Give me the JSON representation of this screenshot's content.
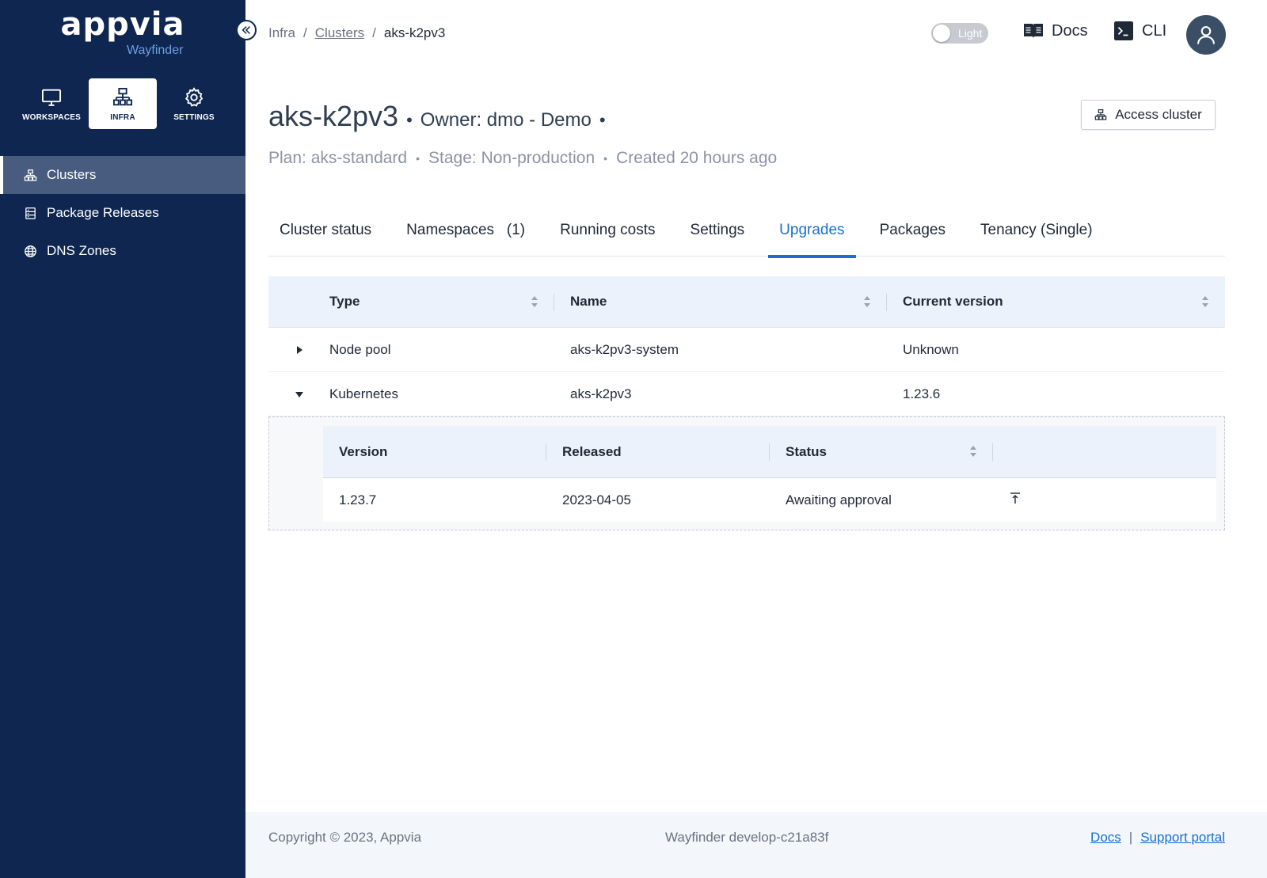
{
  "brand": {
    "name": "appvia",
    "product": "Wayfinder"
  },
  "topnav": [
    {
      "label": "WORKSPACES",
      "icon": "monitor-icon"
    },
    {
      "label": "INFRA",
      "icon": "network-icon",
      "active": true
    },
    {
      "label": "SETTINGS",
      "icon": "gear-icon"
    }
  ],
  "sidenav": [
    {
      "label": "Clusters",
      "icon": "cluster-icon",
      "active": true
    },
    {
      "label": "Package Releases",
      "icon": "package-icon"
    },
    {
      "label": "DNS Zones",
      "icon": "globe-icon"
    }
  ],
  "breadcrumb": {
    "root": "Infra",
    "sep": "/",
    "parent": "Clusters",
    "current": "aks-k2pv3"
  },
  "header": {
    "theme_toggle": "Light",
    "docs": "Docs",
    "cli": "CLI"
  },
  "cluster": {
    "name": "aks-k2pv3",
    "owner": "Owner: dmo - Demo",
    "dot": "•",
    "plan": "Plan: aks-standard",
    "stage": "Stage: Non-production",
    "created": "Created 20 hours ago",
    "access_button": "Access cluster"
  },
  "tabs": [
    {
      "label": "Cluster status"
    },
    {
      "label": "Namespaces   (1)"
    },
    {
      "label": "Running costs"
    },
    {
      "label": "Settings"
    },
    {
      "label": "Upgrades",
      "active": true
    },
    {
      "label": "Packages"
    },
    {
      "label": "Tenancy (Single)"
    }
  ],
  "upgrades_table": {
    "columns": [
      "Type",
      "Name",
      "Current version"
    ],
    "rows": [
      {
        "type": "Node pool",
        "name": "aks-k2pv3-system",
        "version": "Unknown",
        "expanded": false
      },
      {
        "type": "Kubernetes",
        "name": "aks-k2pv3",
        "version": "1.23.6",
        "expanded": true
      }
    ]
  },
  "versions_table": {
    "columns": [
      "Version",
      "Released",
      "Status"
    ],
    "rows": [
      {
        "version": "1.23.7",
        "released": "2023-04-05",
        "status": "Awaiting approval"
      }
    ]
  },
  "footer": {
    "copyright": "Copyright © 2023, Appvia",
    "build": "Wayfinder develop-c21a83f",
    "docs": "Docs",
    "separator": "|",
    "support": "Support portal"
  },
  "colors": {
    "sidebar": "#0f2650",
    "accent": "#1a6fd0",
    "header_row": "#ecf2fb"
  }
}
